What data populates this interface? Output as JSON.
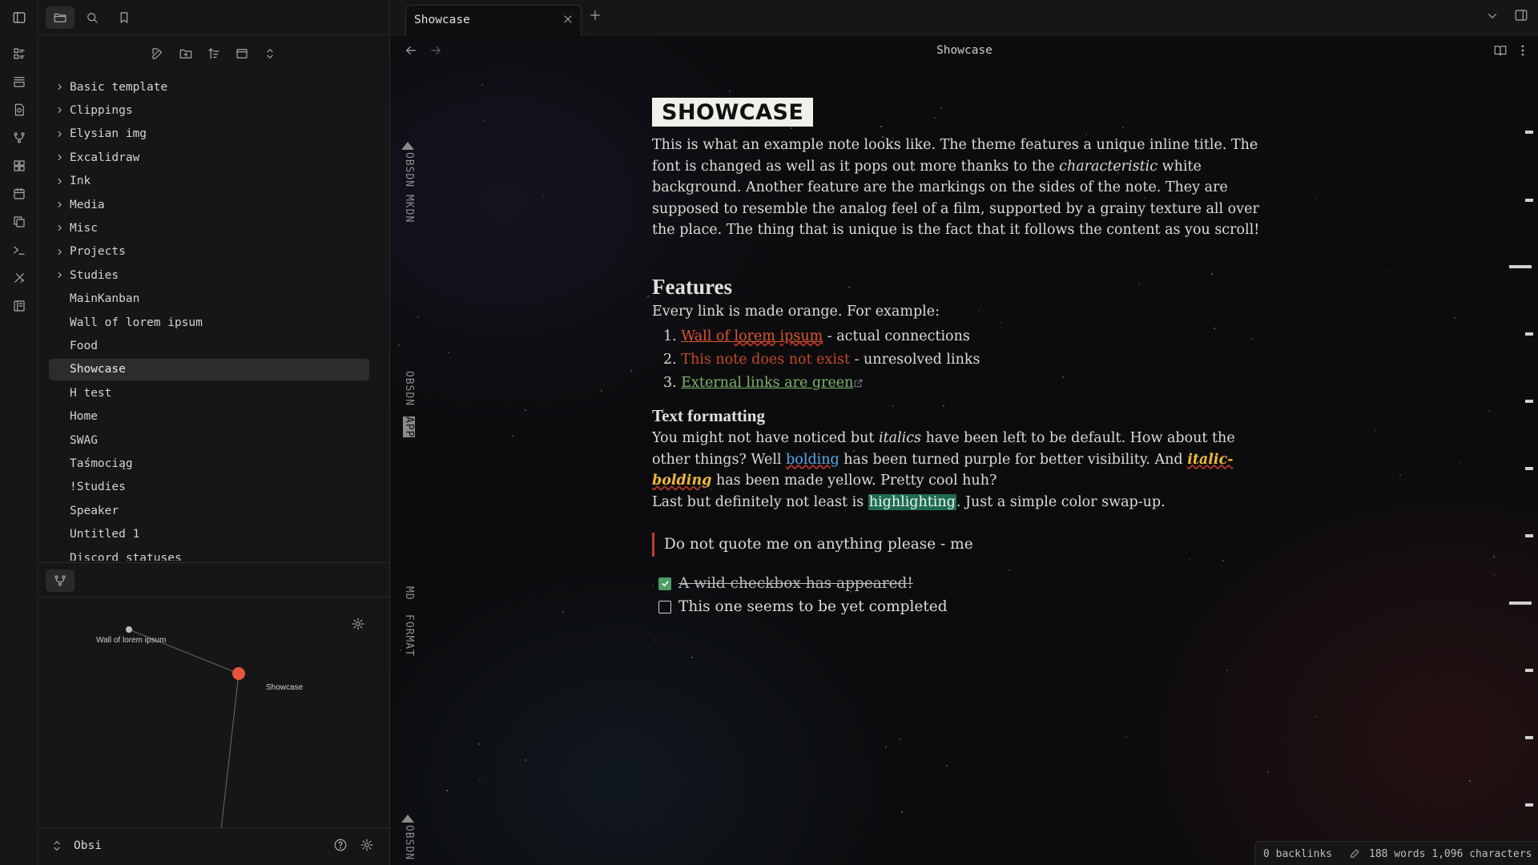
{
  "app": {
    "ribbon_icons": [
      "toggle-sidebar-icon",
      "files-icon",
      "search-icon",
      "bookmarks-icon",
      "dashboard-icon",
      "new-note-icon",
      "template-icon",
      "graph-icon",
      "canvas-icon",
      "calendar-icon",
      "copy-icon",
      "terminal-icon",
      "tools-icon",
      "kanban-icon"
    ]
  },
  "file_tree": {
    "folders": [
      "Basic template",
      "Clippings",
      "Elysian img",
      "Excalidraw",
      "Ink",
      "Media",
      "Misc",
      "Projects",
      "Studies"
    ],
    "files": [
      "MainKanban",
      "Wall of lorem ipsum",
      "Food",
      "Showcase",
      "H test",
      "Home",
      "SWAG",
      "Taśmociąg",
      "!Studies",
      "Speaker",
      "Untitled 1",
      "Discord statuses"
    ],
    "selected": "Showcase"
  },
  "graph": {
    "nodes": [
      "Wall of lorem ipsum",
      "Showcase"
    ]
  },
  "vault": {
    "name": "Obsi"
  },
  "tab": {
    "title": "Showcase"
  },
  "view": {
    "title": "Showcase"
  },
  "film_labels": [
    "OBSDN MKDN",
    "OBSDN",
    "APP",
    "MD",
    "FORMAT",
    "OBSDN"
  ],
  "note": {
    "inline_title": "SHOWCASE",
    "intro_a": "This is what an example note looks like. The theme features a unique inline title. The font is changed as well as it pops out more thanks to the ",
    "intro_em": "characteristic",
    "intro_b": " white background. Another feature are the markings on the sides of the note. They are supposed to resemble the analog feel of a film, supported by a grainy texture all over the place. The thing that is unique is the fact that it follows the content as you scroll!",
    "h_features": "Features",
    "features_intro": "Every link is made orange. For example:",
    "list": [
      {
        "num": "1.",
        "w1": "Wall of ",
        "w2": "lorem",
        "w3": " ",
        "w4": "ipsum",
        "rest": " - actual connections"
      },
      {
        "num": "2.",
        "link": "This note does not exist",
        "rest": " - unresolved links"
      },
      {
        "num": "3.",
        "link": "External links are green",
        "ext_icon": "external-link-icon"
      }
    ],
    "h_formatting": "Text formatting",
    "fmt_a": "You might not have noticed but ",
    "fmt_italics": "italics",
    "fmt_b": " have been left to be default. How about the other things? Well ",
    "fmt_bolding": "bolding",
    "fmt_c": " has been turned purple for better visibility.  And ",
    "fmt_italic_bolding": "italic-bolding",
    "fmt_d": " has been made yellow. Pretty cool huh?",
    "fmt_e": "Last but definitely not least is ",
    "fmt_highlight": "highlighting",
    "fmt_f": ". Just a simple color swap-up.",
    "quote": "Do not quote me on anything please - me",
    "tasks": [
      {
        "text": "A wild checkbox has appeared!",
        "checked": true
      },
      {
        "text": "This one seems to be yet completed",
        "checked": false
      }
    ]
  },
  "status": {
    "backlinks": "0 backlinks",
    "counts": "188 words 1,096 characters"
  },
  "colors": {
    "link": "#e0562f",
    "external": "#7fb36b",
    "bold": "#59a9e6",
    "italic_bold": "#f0b93a",
    "highlight": "#1e6b52",
    "graph_active": "#e8553f"
  }
}
